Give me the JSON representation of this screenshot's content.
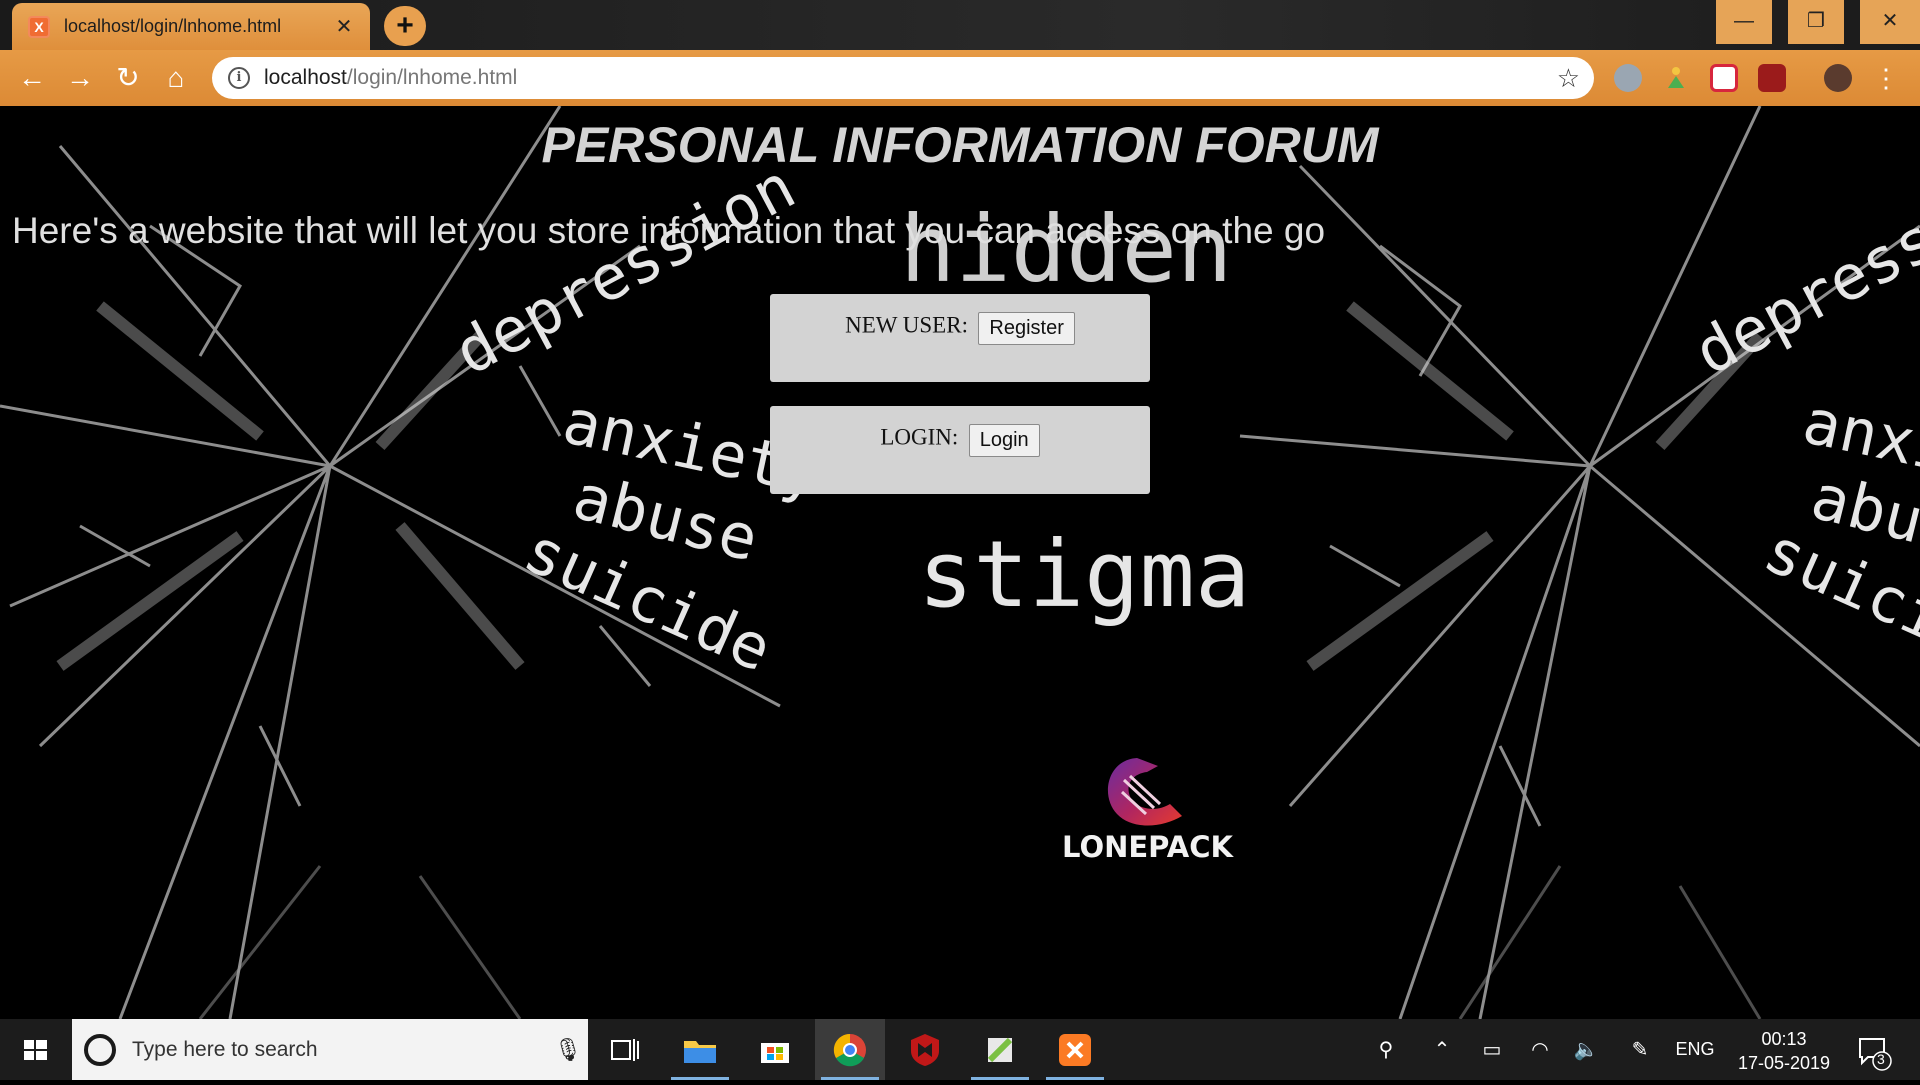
{
  "browser": {
    "tab_title": "localhost/login/lnhome.html",
    "url_host": "localhost",
    "url_path": "/login/lnhome.html",
    "tab_close_glyph": "✕",
    "new_tab_glyph": "+",
    "back_glyph": "←",
    "forward_glyph": "→",
    "reload_glyph": "↻",
    "home_glyph": "⌂",
    "info_glyph": "i",
    "star_glyph": "☆",
    "minimize_glyph": "—",
    "maximize_glyph": "❐",
    "close_glyph": "✕",
    "menu_glyph": "⋮"
  },
  "page": {
    "title": "PERSONAL INFORMATION FORUM",
    "tagline": "Here's a website that will let you store information that you can access on the go",
    "new_user_label": "NEW USER:",
    "register_button": "Register",
    "login_label": "LOGIN:",
    "login_button": "Login",
    "logo_text": "LONEPACK"
  },
  "background_words": [
    "depression",
    "anxiety",
    "abuse",
    "suicide",
    "stigma"
  ],
  "taskbar": {
    "search_placeholder": "Type here to search",
    "language": "ENG",
    "time": "00:13",
    "date": "17-05-2019",
    "notification_count": "3"
  },
  "colors": {
    "chrome_orange": "#e69a45",
    "card_gray": "#d3d3d3",
    "title_gray": "#d4d4d4",
    "taskbar": "#1c1c1c"
  }
}
